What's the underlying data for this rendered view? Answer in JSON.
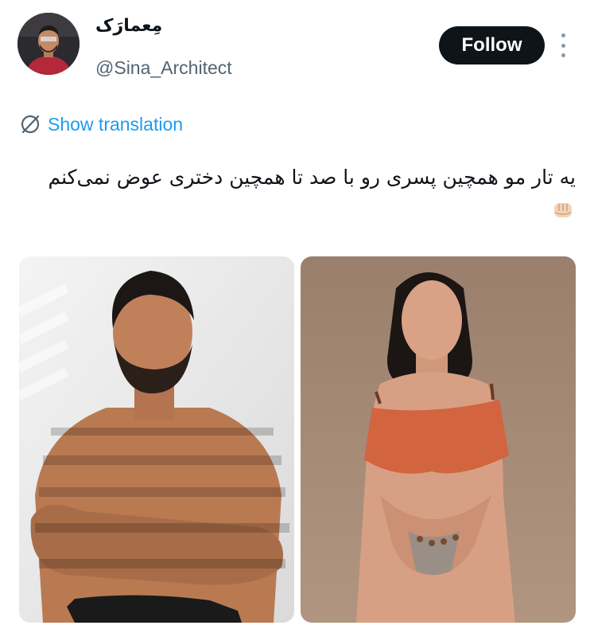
{
  "author": {
    "display_name": "مِعمارَک",
    "handle": "@Sina_Architect",
    "avatar_icon": "user-avatar"
  },
  "actions": {
    "follow_label": "Follow",
    "more_icon": "more-vertical-icon"
  },
  "translation": {
    "label": "Show translation",
    "icon": "globe-translate-icon",
    "color": "#1d9bf0"
  },
  "tweet": {
    "text": "یه تار مو همچین پسری رو با صد تا همچین دختری عوض نمی‌کنم",
    "emoji": "fist-bump-emoji"
  },
  "media": [
    {
      "name": "photo-bearded-man",
      "bg": "#e9e9ea",
      "skin": "#b97a52"
    },
    {
      "name": "photo-woman-orange-top",
      "bg": "#a58a77",
      "skin": "#d7a084",
      "accent": "#d2643f"
    }
  ],
  "colors": {
    "text_primary": "#0f1419",
    "text_secondary": "#536471",
    "follow_bg": "#0f1419",
    "follow_fg": "#ffffff"
  }
}
